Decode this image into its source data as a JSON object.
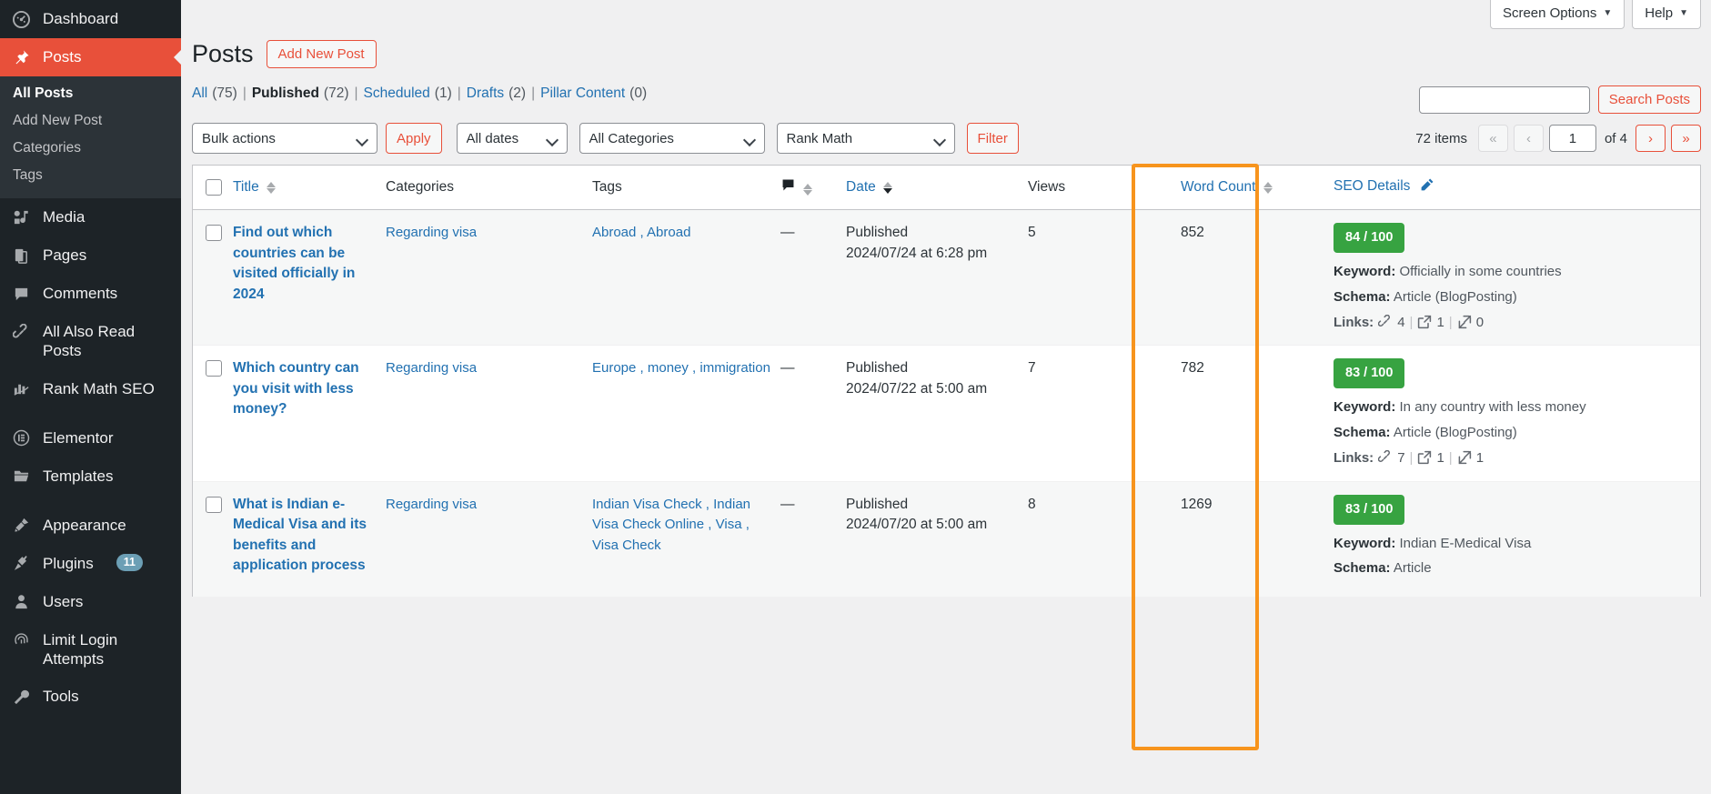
{
  "theme": {
    "accent": "#e8503a",
    "link": "#2271b1",
    "sidebar_bg": "#1d2327",
    "submenu_bg": "#2c3338",
    "highlight": "#f7941d",
    "score_green": "#37a341"
  },
  "sidebar": {
    "items": [
      {
        "label": "Dashboard",
        "icon": "dashboard-icon",
        "current": false
      },
      {
        "label": "Posts",
        "icon": "pin-icon",
        "current": true
      },
      {
        "label": "Media",
        "icon": "media-icon",
        "current": false
      },
      {
        "label": "Pages",
        "icon": "pages-icon",
        "current": false
      },
      {
        "label": "Comments",
        "icon": "comment-icon",
        "current": false
      },
      {
        "label": "All Also Read Posts",
        "icon": "link-icon",
        "current": false
      },
      {
        "label": "Rank Math SEO",
        "icon": "chart-icon",
        "current": false
      },
      {
        "label": "Elementor",
        "icon": "elementor-icon",
        "current": false
      },
      {
        "label": "Templates",
        "icon": "folder-icon",
        "current": false
      },
      {
        "label": "Appearance",
        "icon": "brush-icon",
        "current": false
      },
      {
        "label": "Plugins",
        "icon": "plug-icon",
        "current": false,
        "badge": "11"
      },
      {
        "label": "Users",
        "icon": "user-icon",
        "current": false
      },
      {
        "label": "Limit Login Attempts",
        "icon": "fingerprint-icon",
        "current": false
      },
      {
        "label": "Tools",
        "icon": "tools-icon",
        "current": false
      }
    ],
    "submenu": [
      {
        "label": "All Posts",
        "current": true
      },
      {
        "label": "Add New Post",
        "current": false
      },
      {
        "label": "Categories",
        "current": false
      },
      {
        "label": "Tags",
        "current": false
      }
    ]
  },
  "topbar": {
    "screen_options": "Screen Options",
    "help": "Help",
    "caret": "▼"
  },
  "header": {
    "title": "Posts",
    "add_new_label": "Add New Post"
  },
  "search": {
    "value": "",
    "placeholder": "",
    "button_label": "Search Posts"
  },
  "status_links": [
    {
      "label": "All",
      "count": "(75)",
      "current": false
    },
    {
      "label": "Published",
      "count": "(72)",
      "current": true
    },
    {
      "label": "Scheduled",
      "count": "(1)",
      "current": false
    },
    {
      "label": "Drafts",
      "count": "(2)",
      "current": false
    },
    {
      "label": "Pillar Content",
      "count": "(0)",
      "current": false
    }
  ],
  "tablenav": {
    "bulk_actions": "Bulk actions",
    "apply_label": "Apply",
    "all_dates": "All dates",
    "all_categories": "All Categories",
    "rank_math": "Rank Math",
    "filter_label": "Filter",
    "items_count": "72 items",
    "first_page": "«",
    "prev_page": "‹",
    "current_page": "1",
    "of_total": "of 4",
    "next_page": "›",
    "last_page": "»"
  },
  "table": {
    "columns": {
      "title": "Title",
      "categories": "Categories",
      "tags": "Tags",
      "comments": "comments-icon",
      "date": "Date",
      "views": "Views",
      "word_count": "Word Count",
      "seo_details": "SEO Details"
    },
    "rows": [
      {
        "title": "Find out which countries can be visited officially in 2024",
        "categories": "Regarding visa",
        "tags": "Abroad , Abroad",
        "comments": "—",
        "date_status": "Published",
        "date_value": "2024/07/24 at 6:28 pm",
        "views": "5",
        "word_count": "852",
        "seo": {
          "score": "84 / 100",
          "keyword_label": "Keyword:",
          "keyword": "Officially in some countries",
          "schema_label": "Schema:",
          "schema": "Article (BlogPosting)",
          "links_label": "Links:",
          "internal_links": "4",
          "external_links": "1",
          "incoming_links": "0"
        }
      },
      {
        "title": "Which country can you visit with less money?",
        "categories": "Regarding visa",
        "tags": "Europe , money , immigration",
        "comments": "—",
        "date_status": "Published",
        "date_value": "2024/07/22 at 5:00 am",
        "views": "7",
        "word_count": "782",
        "seo": {
          "score": "83 / 100",
          "keyword_label": "Keyword:",
          "keyword": "In any country with less money",
          "schema_label": "Schema:",
          "schema": "Article (BlogPosting)",
          "links_label": "Links:",
          "internal_links": "7",
          "external_links": "1",
          "incoming_links": "1"
        }
      },
      {
        "title": "What is Indian e-Medical Visa and its benefits and application process",
        "categories": "Regarding visa",
        "tags": "Indian Visa Check , Indian Visa Check Online , Visa , Visa Check",
        "comments": "—",
        "date_status": "Published",
        "date_value": "2024/07/20 at 5:00 am",
        "views": "8",
        "word_count": "1269",
        "seo": {
          "score": "83 / 100",
          "keyword_label": "Keyword:",
          "keyword": "Indian E-Medical Visa",
          "schema_label": "Schema:",
          "schema": "Article",
          "links_label": "",
          "internal_links": "",
          "external_links": "",
          "incoming_links": ""
        }
      }
    ]
  }
}
